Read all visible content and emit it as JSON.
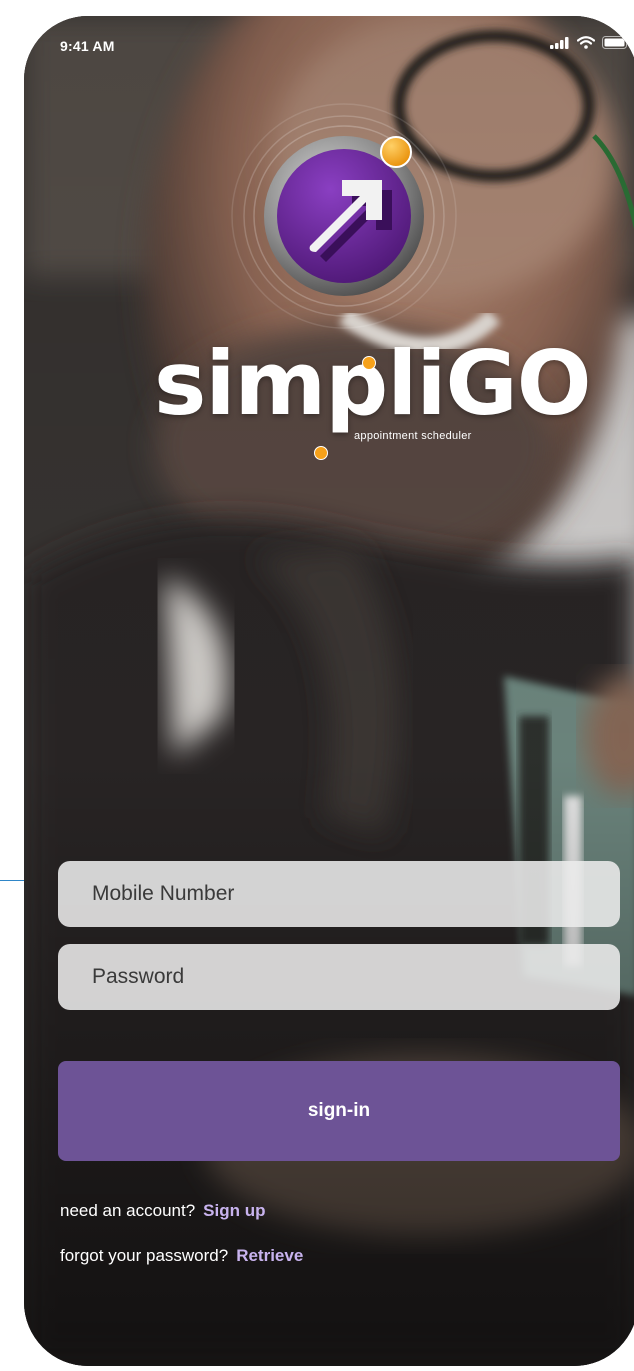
{
  "status_bar": {
    "time": "9:41 AM",
    "icons": [
      "cellular-signal-icon",
      "wifi-icon",
      "battery-icon"
    ]
  },
  "brand": {
    "logo_icon": "arrow-up-right-icon",
    "name": "simpliGO",
    "tagline": "appointment scheduler"
  },
  "form": {
    "mobile_placeholder": "Mobile Number",
    "mobile_value": "",
    "password_placeholder": "Password",
    "password_value": "",
    "signin_label": "sign-in"
  },
  "footer": {
    "account_prompt": "need an account?",
    "signup_link": "Sign up",
    "password_prompt": "forgot your password?",
    "retrieve_link": "Retrieve"
  },
  "colors": {
    "primary_button": "#6d5396",
    "link": "#c8b3ee",
    "accent_orange": "#f6a11a",
    "logo_purple": "#5b1f86"
  }
}
